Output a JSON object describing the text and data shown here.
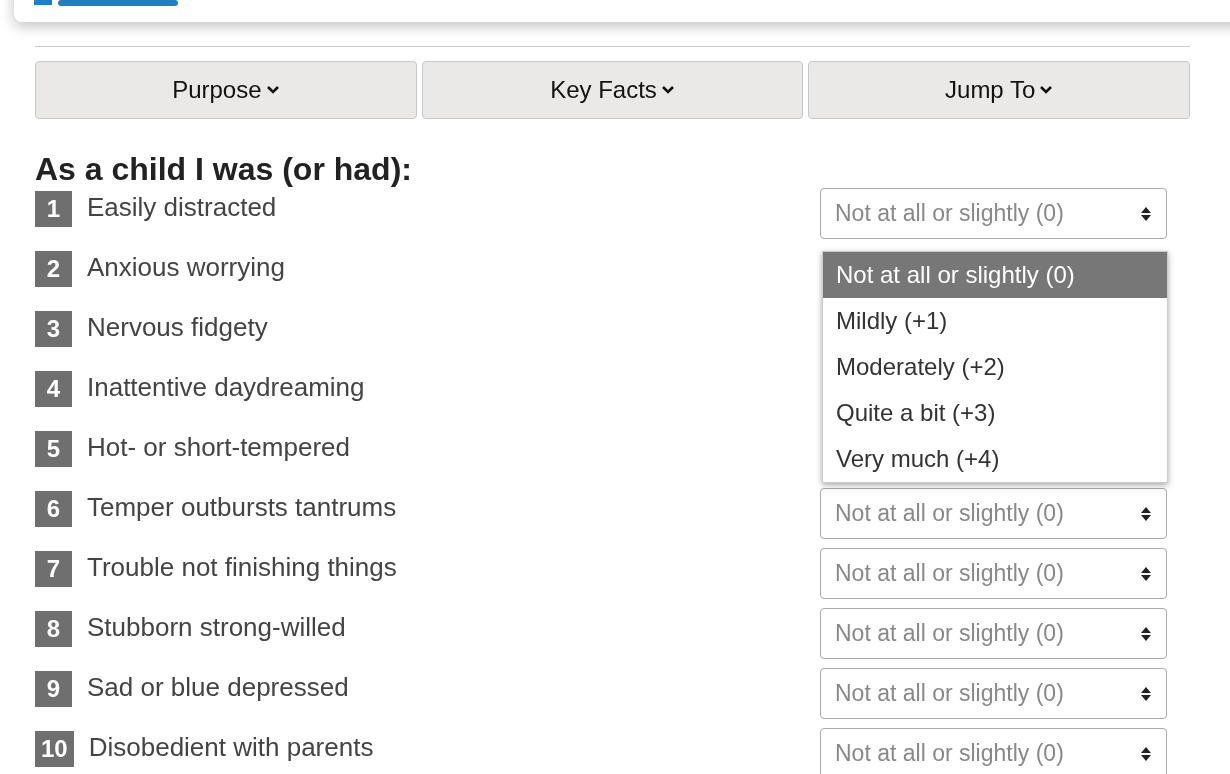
{
  "nav_buttons": [
    {
      "label": "Purpose"
    },
    {
      "label": "Key Facts"
    },
    {
      "label": "Jump To"
    }
  ],
  "heading": "As a child I was (or had):",
  "rows": [
    {
      "number": "1",
      "label": "Easily distracted",
      "value": "Not at all or slightly (0)"
    },
    {
      "number": "2",
      "label": "Anxious worrying"
    },
    {
      "number": "3",
      "label": "Nervous fidgety"
    },
    {
      "number": "4",
      "label": "Inattentive daydreaming"
    },
    {
      "number": "5",
      "label": "Hot- or short-tempered"
    },
    {
      "number": "6",
      "label": "Temper outbursts tantrums",
      "value": "Not at all or slightly (0)"
    },
    {
      "number": "7",
      "label": "Trouble not finishing things",
      "value": "Not at all or slightly (0)"
    },
    {
      "number": "8",
      "label": "Stubborn strong-willed",
      "value": "Not at all or slightly (0)"
    },
    {
      "number": "9",
      "label": "Sad or blue depressed",
      "value": "Not at all or slightly (0)"
    },
    {
      "number": "10",
      "label": "Disobedient with parents",
      "value": "Not at all or slightly (0)"
    }
  ],
  "dropdown": {
    "options": [
      {
        "label": "Not at all or slightly (0)",
        "selected": true
      },
      {
        "label": "Mildly (+1)",
        "selected": false
      },
      {
        "label": "Moderately (+2)",
        "selected": false
      },
      {
        "label": "Quite a bit (+3)",
        "selected": false
      },
      {
        "label": "Very much (+4)",
        "selected": false
      }
    ]
  }
}
